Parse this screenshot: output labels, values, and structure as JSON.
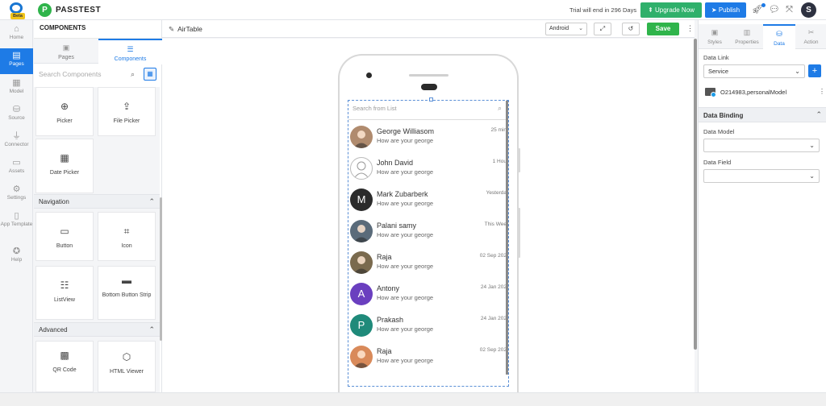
{
  "app": {
    "beta_label": "Beta",
    "project_initial": "P",
    "project_name": "PASSTEST"
  },
  "topbar": {
    "trial_text": "Trial will end in 296 Days",
    "upgrade_label": "Upgrade Now",
    "publish_label": "Publish",
    "user_initial": "S"
  },
  "leftnav": [
    {
      "label": "Home",
      "icon": "home-icon"
    },
    {
      "label": "Pages",
      "icon": "pages-icon",
      "active": true
    },
    {
      "label": "Model",
      "icon": "model-icon"
    },
    {
      "label": "Source",
      "icon": "database-icon"
    },
    {
      "label": "Connector",
      "icon": "plug-icon"
    },
    {
      "label": "Assets",
      "icon": "image-icon"
    },
    {
      "label": "Settings",
      "icon": "gear-icon"
    },
    {
      "label": "App Template",
      "icon": "template-icon"
    },
    {
      "label": "Help",
      "icon": "bulb-icon"
    }
  ],
  "components": {
    "title": "COMPONENTS",
    "tabs": [
      {
        "label": "Pages"
      },
      {
        "label": "Components",
        "active": true
      }
    ],
    "search_placeholder": "Search Components",
    "basic_tiles": [
      "Picker",
      "File Picker",
      "Date Picker"
    ],
    "navigation_title": "Navigation",
    "navigation_tiles": [
      "Button",
      "Icon",
      "ListView",
      "Bottom Button Strip"
    ],
    "advanced_title": "Advanced",
    "advanced_tiles": [
      "QR Code",
      "HTML Viewer"
    ]
  },
  "canvas": {
    "page_title": "AirTable",
    "device_select": "Android",
    "save_label": "Save"
  },
  "list": {
    "search_placeholder": "Search from List",
    "rows": [
      {
        "name": "George Williasom",
        "message": "How are your george",
        "time": "25 min",
        "avatar": "photo",
        "color": "#b08b6e"
      },
      {
        "name": "John David",
        "message": "How are your george",
        "time": "1 Hou",
        "avatar": "outline",
        "color": "#ffffff"
      },
      {
        "name": "Mark Zubarberk",
        "message": "How are your george",
        "time": "Yesterda",
        "avatar": "M",
        "color": "#2b2b2b"
      },
      {
        "name": "Palani samy",
        "message": "How are your george",
        "time": "This Wee",
        "avatar": "photo",
        "color": "#5a6b7a"
      },
      {
        "name": "Raja",
        "message": "How are your george",
        "time": "02 Sep 202",
        "avatar": "photo",
        "color": "#7a6a4e"
      },
      {
        "name": "Antony",
        "message": "How are your george",
        "time": "24 Jan 202",
        "avatar": "A",
        "color": "#6a3fbf"
      },
      {
        "name": "Prakash",
        "message": "How are your george",
        "time": "24 Jan 202",
        "avatar": "P",
        "color": "#1f8a7a"
      },
      {
        "name": "Raja",
        "message": "How are your george",
        "time": "02 Sep 202",
        "avatar": "photo",
        "color": "#d98a5a"
      }
    ]
  },
  "rpanel": {
    "tabs": [
      {
        "label": "Styles"
      },
      {
        "label": "Properties"
      },
      {
        "label": "Data",
        "active": true
      },
      {
        "label": "Action"
      }
    ],
    "data_link_label": "Data Link",
    "data_link_value": "Service",
    "model_name": "O214983,personalModel",
    "binding_title": "Data Binding",
    "data_model_label": "Data Model",
    "data_model_value": "",
    "data_field_label": "Data Field",
    "data_field_value": ""
  }
}
